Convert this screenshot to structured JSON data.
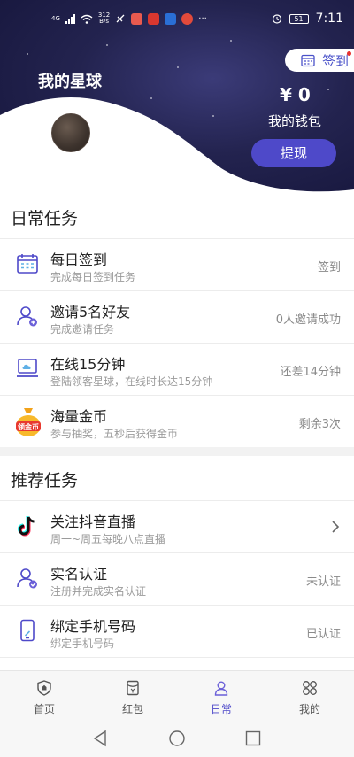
{
  "status_bar": {
    "network": "4G",
    "speed_value": "312",
    "speed_unit": "B/s",
    "battery": "51",
    "time": "7:11"
  },
  "header": {
    "signin_label": "签到",
    "title": "我的星球",
    "wallet_amount": "¥ 0",
    "wallet_label": "我的钱包",
    "withdraw_label": "提现"
  },
  "daily_tasks": {
    "title": "日常任务",
    "items": [
      {
        "title": "每日签到",
        "subtitle": "完成每日签到任务",
        "status": "签到",
        "icon": "calendar-icon"
      },
      {
        "title": "邀请5名好友",
        "subtitle": "完成邀请任务",
        "status": "0人邀请成功",
        "icon": "add-user-icon"
      },
      {
        "title": "在线15分钟",
        "subtitle": "登陆领客星球，在线时长达15分钟",
        "status": "还差14分钟",
        "icon": "cloud-laptop-icon"
      },
      {
        "title": "海量金币",
        "subtitle": "参与抽奖，五秒后获得金币",
        "status": "剩余3次",
        "icon": "coin-bag-icon",
        "icon_text": "领金币"
      }
    ]
  },
  "recommended_tasks": {
    "title": "推荐任务",
    "items": [
      {
        "title": "关注抖音直播",
        "subtitle": "周一~周五每晚八点直播",
        "status": "",
        "icon": "tiktok-icon"
      },
      {
        "title": "实名认证",
        "subtitle": "注册并完成实名认证",
        "status": "未认证",
        "icon": "verified-user-icon"
      },
      {
        "title": "绑定手机号码",
        "subtitle": "绑定手机号码",
        "status": "已认证",
        "icon": "phone-icon"
      }
    ]
  },
  "bottom_nav": {
    "items": [
      {
        "label": "首页",
        "icon": "home-shield-icon"
      },
      {
        "label": "红包",
        "icon": "red-packet-icon"
      },
      {
        "label": "日常",
        "icon": "user-daily-icon",
        "active": true
      },
      {
        "label": "我的",
        "icon": "grid-mine-icon"
      }
    ]
  },
  "colors": {
    "accent": "#4e49c9",
    "hero_dark": "#1a1a40",
    "muted_text": "#9a9a9a"
  }
}
